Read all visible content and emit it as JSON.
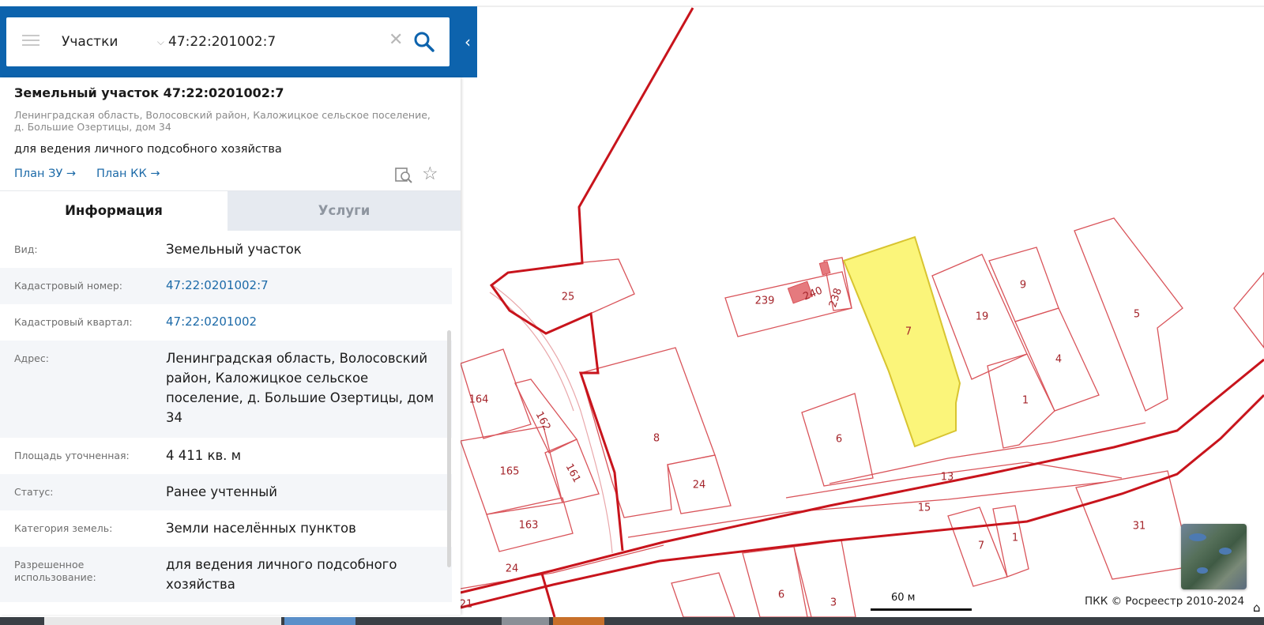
{
  "search": {
    "layer_label": "Участки",
    "query": "47:22:201002:7"
  },
  "parcel": {
    "title": "Земельный участок 47:22:0201002:7",
    "address": "Ленинградская область, Волосовский район, Каложицкое сельское поселение, д. Большие Озертицы, дом 34",
    "use": "для ведения личного подсобного хозяйства",
    "plan_zu": "План ЗУ →",
    "plan_kk": "План КК →"
  },
  "tabs": {
    "info": "Информация",
    "services": "Услуги"
  },
  "rows": [
    {
      "label": "Вид:",
      "value": "Земельный участок"
    },
    {
      "label": "Кадастровый номер:",
      "value": "47:22:0201002:7"
    },
    {
      "label": "Кадастровый квартал:",
      "value": "47:22:0201002"
    },
    {
      "label": "Адрес:",
      "value": "Ленинградская область, Волосовский район, Каложицкое сельское поселение, д. Большие Озертицы, дом 34"
    },
    {
      "label": "Площадь уточненная:",
      "value": "4 411 кв. м"
    },
    {
      "label": "Статус:",
      "value": "Ранее учтенный"
    },
    {
      "label": "Категория земель:",
      "value": "Земли населённых пунктов"
    },
    {
      "label": "Разрешенное использование:",
      "value": "для ведения личного подсобного хозяйства"
    }
  ],
  "map": {
    "parcel_labels": [
      "25",
      "239",
      "240",
      "238",
      "7",
      "19",
      "9",
      "5",
      "4",
      "1",
      "164",
      "162",
      "8",
      "6",
      "165",
      "161",
      "24",
      "13",
      "163",
      "15",
      "31",
      "7",
      "1",
      "24",
      "6",
      "3",
      "21"
    ],
    "scale_label": "60 м",
    "attribution": "ПКК © Росреестр 2010-2024",
    "colors": {
      "boundary": "#c8141c",
      "parcel_line": "#d9545a",
      "selected_fill": "#fbf57a",
      "selected_stroke": "#d8c430",
      "building_fill": "#e57a7e",
      "brand_blue": "#0d63ad",
      "link_blue": "#1c6aa8"
    }
  }
}
